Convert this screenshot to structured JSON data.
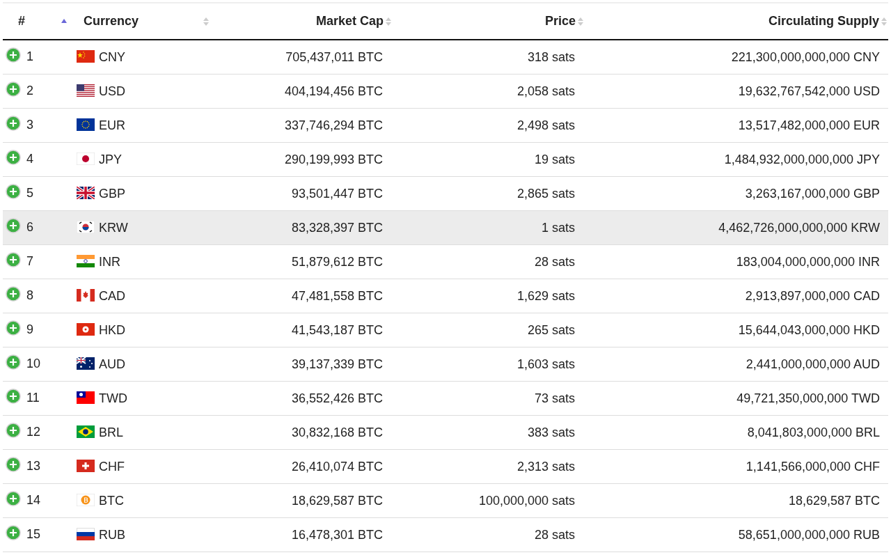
{
  "table": {
    "columns": [
      {
        "label": "#",
        "sorted": true
      },
      {
        "label": "Currency",
        "sorted": false
      },
      {
        "label": "Market Cap",
        "sorted": false
      },
      {
        "label": "Price",
        "sorted": false
      },
      {
        "label": "Circulating Supply",
        "sorted": false
      }
    ],
    "rows": [
      {
        "rank": "1",
        "currency": "CNY",
        "market_cap": "705,437,011 BTC",
        "price": "318 sats",
        "supply": "221,300,000,000,000 CNY",
        "highlighted": false
      },
      {
        "rank": "2",
        "currency": "USD",
        "market_cap": "404,194,456 BTC",
        "price": "2,058 sats",
        "supply": "19,632,767,542,000 USD",
        "highlighted": false
      },
      {
        "rank": "3",
        "currency": "EUR",
        "market_cap": "337,746,294 BTC",
        "price": "2,498 sats",
        "supply": "13,517,482,000,000 EUR",
        "highlighted": false
      },
      {
        "rank": "4",
        "currency": "JPY",
        "market_cap": "290,199,993 BTC",
        "price": "19 sats",
        "supply": "1,484,932,000,000,000 JPY",
        "highlighted": false
      },
      {
        "rank": "5",
        "currency": "GBP",
        "market_cap": "93,501,447 BTC",
        "price": "2,865 sats",
        "supply": "3,263,167,000,000 GBP",
        "highlighted": false
      },
      {
        "rank": "6",
        "currency": "KRW",
        "market_cap": "83,328,397 BTC",
        "price": "1 sats",
        "supply": "4,462,726,000,000,000 KRW",
        "highlighted": true
      },
      {
        "rank": "7",
        "currency": "INR",
        "market_cap": "51,879,612 BTC",
        "price": "28 sats",
        "supply": "183,004,000,000,000 INR",
        "highlighted": false
      },
      {
        "rank": "8",
        "currency": "CAD",
        "market_cap": "47,481,558 BTC",
        "price": "1,629 sats",
        "supply": "2,913,897,000,000 CAD",
        "highlighted": false
      },
      {
        "rank": "9",
        "currency": "HKD",
        "market_cap": "41,543,187 BTC",
        "price": "265 sats",
        "supply": "15,644,043,000,000 HKD",
        "highlighted": false
      },
      {
        "rank": "10",
        "currency": "AUD",
        "market_cap": "39,137,339 BTC",
        "price": "1,603 sats",
        "supply": "2,441,000,000,000 AUD",
        "highlighted": false
      },
      {
        "rank": "11",
        "currency": "TWD",
        "market_cap": "36,552,426 BTC",
        "price": "73 sats",
        "supply": "49,721,350,000,000 TWD",
        "highlighted": false
      },
      {
        "rank": "12",
        "currency": "BRL",
        "market_cap": "30,832,168 BTC",
        "price": "383 sats",
        "supply": "8,041,803,000,000 BRL",
        "highlighted": false
      },
      {
        "rank": "13",
        "currency": "CHF",
        "market_cap": "26,410,074 BTC",
        "price": "2,313 sats",
        "supply": "1,141,566,000,000 CHF",
        "highlighted": false
      },
      {
        "rank": "14",
        "currency": "BTC",
        "market_cap": "18,629,587 BTC",
        "price": "100,000,000 sats",
        "supply": "18,629,587 BTC",
        "highlighted": false
      },
      {
        "rank": "15",
        "currency": "RUB",
        "market_cap": "16,478,301 BTC",
        "price": "28 sats",
        "supply": "58,651,000,000,000 RUB",
        "highlighted": false
      }
    ]
  }
}
